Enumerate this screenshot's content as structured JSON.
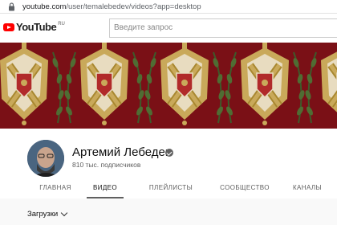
{
  "browser": {
    "url_host": "youtube.com",
    "url_path": "/user/temalebedev/videos?app=desktop"
  },
  "header": {
    "logo_text": "YouTube",
    "region": "RU",
    "search_placeholder": "Введите запрос"
  },
  "channel": {
    "name": "Артемий Лебедев",
    "subscribers": "810 тыс. подписчиков",
    "verified": true
  },
  "tabs": [
    {
      "label": "ГЛАВНАЯ",
      "active": false
    },
    {
      "label": "ВИДЕО",
      "active": true
    },
    {
      "label": "ПЛЕЙЛИСТЫ",
      "active": false
    },
    {
      "label": "СООБЩЕСТВО",
      "active": false
    },
    {
      "label": "КАНАЛЫ",
      "active": false
    }
  ],
  "content": {
    "section_label": "Загрузки"
  },
  "colors": {
    "brand_red": "#ff0000",
    "banner_red": "#7a1016",
    "banner_gold": "#c9a95a",
    "banner_green": "#3d5a2a"
  }
}
